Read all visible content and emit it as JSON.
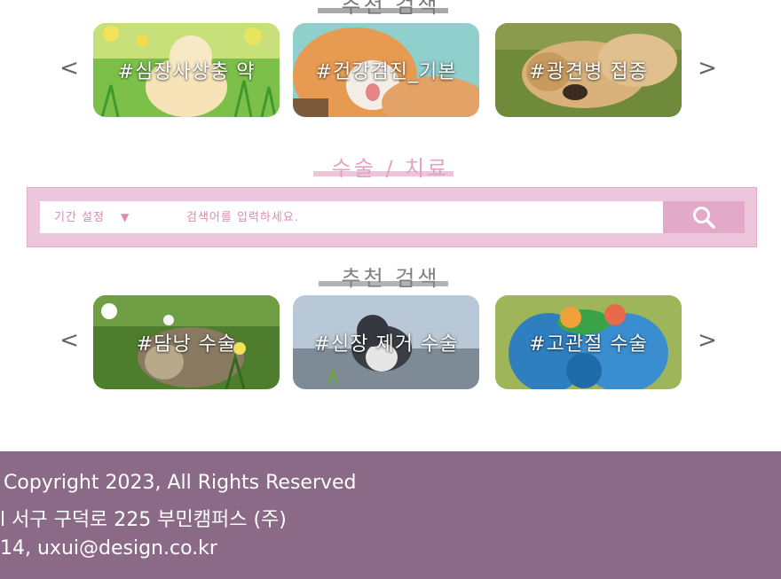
{
  "top_section": {
    "title": "추천 검색",
    "prev_arrow": "<",
    "next_arrow": ">",
    "cards": [
      {
        "label": "#심장사상충 약",
        "image": "chick-photo"
      },
      {
        "label": "#건강검진_기본",
        "image": "cat-photo"
      },
      {
        "label": "#광견병 접종",
        "image": "puppy-photo"
      }
    ]
  },
  "surgery_section": {
    "title": "수술 / 치료",
    "search": {
      "period_label": "기간 설정",
      "caret": "▼",
      "placeholder": "검색어를 입력하세요.",
      "button_icon": "search-icon"
    }
  },
  "recommend_section": {
    "title": "추천 검색",
    "prev_arrow": "<",
    "next_arrow": ">",
    "cards": [
      {
        "label": "#담낭 수술",
        "image": "hedgehog-photo"
      },
      {
        "label": "#신장 제거 수술",
        "image": "kitten-photo"
      },
      {
        "label": "#고관절 수술",
        "image": "parrot-photo"
      }
    ]
  },
  "footer": {
    "line1": "Copyright 2023, All Rights Reserved",
    "line2": "l 서구 구덕로 225 부민캠퍼스 (주)",
    "line3": "14, uxui@design.co.kr"
  },
  "colors": {
    "accent_pink": "#e2a9c8",
    "search_bg": "#ecc7dc",
    "footer_bg": "#8a6a87"
  }
}
